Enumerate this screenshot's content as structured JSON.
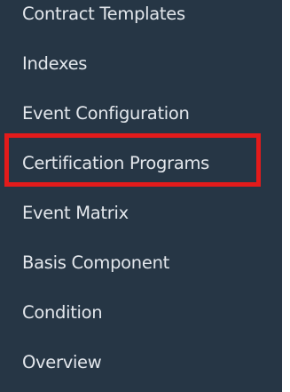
{
  "sidebar": {
    "items": [
      {
        "label": "Contract Templates"
      },
      {
        "label": "Indexes"
      },
      {
        "label": "Event Configuration"
      },
      {
        "label": "Certification Programs"
      },
      {
        "label": "Event Matrix"
      },
      {
        "label": "Basis Component"
      },
      {
        "label": "Condition"
      },
      {
        "label": "Overview"
      }
    ],
    "highlighted_item": "Certification Programs",
    "colors": {
      "background": "#263645",
      "text": "#e3e7ec",
      "highlight_border": "#e31b1b"
    }
  }
}
